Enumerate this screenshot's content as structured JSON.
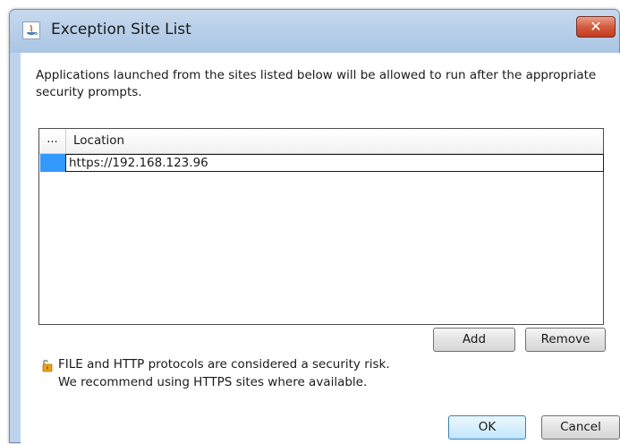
{
  "window": {
    "title": "Exception Site List",
    "close_label": "✕"
  },
  "intro_text": "Applications launched from the sites listed below will be allowed to run after the appropriate security prompts.",
  "table": {
    "columns": [
      "...",
      "Location"
    ],
    "rows": [
      {
        "location": "https://192.168.123.96"
      }
    ]
  },
  "buttons": {
    "add": "Add",
    "remove": "Remove",
    "ok": "OK",
    "cancel": "Cancel"
  },
  "warning": {
    "line1": "FILE and HTTP protocols are considered a security risk.",
    "line2": "We recommend using HTTPS sites where available."
  },
  "colors": {
    "selection": "#3399ff",
    "close_button": "#c94a2e",
    "titlebar": "#b5cde8"
  },
  "icons": {
    "title": "java-icon",
    "warning": "unlocked-padlock-icon"
  }
}
